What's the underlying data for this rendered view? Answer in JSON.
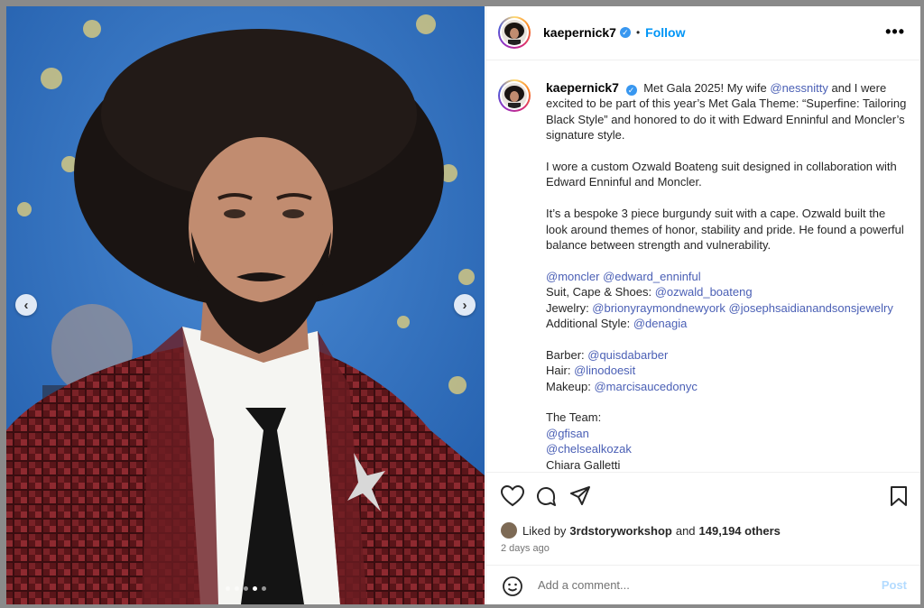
{
  "post": {
    "username": "kaepernick7",
    "follow_label": "Follow",
    "separator": "•",
    "more_label": "•••",
    "caption_paragraphs": [
      [
        {
          "t": "Met Gala 2025! My wife "
        },
        {
          "t": "@nessnitty",
          "m": true
        },
        {
          "t": " and I were excited to be part of this year’s Met Gala Theme: “Superfine: Tailoring Black Style” and honored to do it with Edward Enninful and Moncler’s signature style."
        }
      ],
      [
        {
          "t": "I wore a custom Ozwald Boateng suit designed in collaboration with Edward Enninful and Moncler."
        }
      ],
      [
        {
          "t": "It’s a bespoke 3 piece burgundy suit with a cape. Ozwald built the look around themes of honor, stability and pride. He found a powerful balance between strength and vulnerability."
        }
      ],
      [
        {
          "t": "@moncler",
          "m": true
        },
        {
          "t": " "
        },
        {
          "t": "@edward_enninful",
          "m": true
        },
        {
          "br": true
        },
        {
          "t": "Suit, Cape & Shoes: "
        },
        {
          "t": "@ozwald_boateng",
          "m": true
        },
        {
          "br": true
        },
        {
          "t": "Jewelry: "
        },
        {
          "t": "@brionyraymondnewyork",
          "m": true
        },
        {
          "t": " "
        },
        {
          "t": "@josephsaidianandsonsjewelry",
          "m": true
        },
        {
          "br": true
        },
        {
          "t": "Additional Style: "
        },
        {
          "t": "@denagia",
          "m": true
        }
      ],
      [
        {
          "t": "Barber: "
        },
        {
          "t": "@quisdabarber",
          "m": true
        },
        {
          "br": true
        },
        {
          "t": "Hair: "
        },
        {
          "t": "@linodoesit",
          "m": true
        },
        {
          "br": true
        },
        {
          "t": "Makeup: "
        },
        {
          "t": "@marcisaucedonyc",
          "m": true
        }
      ],
      [
        {
          "t": "The Team:"
        },
        {
          "br": true
        },
        {
          "t": "@gfisan",
          "m": true
        },
        {
          "br": true
        },
        {
          "t": "@chelsealkozak",
          "m": true
        },
        {
          "br": true
        },
        {
          "t": "Chiara Galletti"
        }
      ]
    ],
    "liked_by_prefix": "Liked by",
    "liked_by_user": "3rdstoryworkshop",
    "liked_by_and": "and",
    "likes_count": "149,194 others",
    "timestamp": "2 days ago",
    "comment_placeholder": "Add a comment...",
    "post_label": "Post"
  },
  "carousel": {
    "prev_label": "‹",
    "next_label": "›",
    "slide_count": 5,
    "active_slide": 4
  },
  "colors": {
    "link": "#4a5fb5",
    "follow": "#0095f6",
    "backdrop_blue": "#2f6fc2",
    "suit_burgundy": "#6b1d22"
  }
}
